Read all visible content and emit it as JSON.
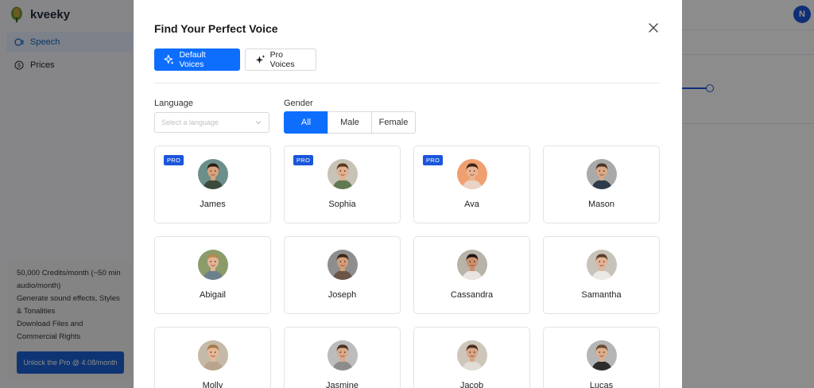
{
  "app": {
    "brand": "kveeky",
    "nav": [
      {
        "label": "Speech",
        "icon": "speech-icon",
        "active": true
      },
      {
        "label": "Prices",
        "icon": "dollar-icon",
        "active": false
      }
    ],
    "promo": {
      "lines": [
        "50,000 Credits/month (~50 min audio/month)",
        "Generate sound effects, Styles & Tonalities",
        "Download Files and Commercial Rights"
      ],
      "cta": "Unlock the Pro @ 4.08/month"
    },
    "user_initial": "N"
  },
  "modal": {
    "title": "Find Your Perfect Voice",
    "tabs": [
      {
        "label": "Default Voices",
        "icon": "sparkle-icon",
        "active": true
      },
      {
        "label": "Pro Voices",
        "icon": "sparkles-icon",
        "active": false
      }
    ],
    "language": {
      "label": "Language",
      "placeholder": "Select a language"
    },
    "gender": {
      "label": "Gender",
      "options": [
        "All",
        "Male",
        "Female"
      ],
      "selected": "All"
    },
    "pro_badge": "PRO",
    "voices": [
      {
        "name": "James",
        "pro": true,
        "hair": "#2b1d14",
        "shirt": "#3c4a3c",
        "skin": "#d9a27b",
        "bg": "#6b8f8a"
      },
      {
        "name": "Sophia",
        "pro": true,
        "hair": "#5a3a22",
        "shirt": "#5f7a53",
        "skin": "#e0b08f",
        "bg": "#c9c2b6"
      },
      {
        "name": "Ava",
        "pro": true,
        "hair": "#3d2417",
        "shirt": "#e9d3c4",
        "skin": "#e8b594",
        "bg": "#f0a070"
      },
      {
        "name": "Mason",
        "pro": false,
        "hair": "#4a3424",
        "shirt": "#2d3b4a",
        "skin": "#d8a886",
        "bg": "#a9a9a9"
      },
      {
        "name": "Abigail",
        "pro": false,
        "hair": "#b48a4e",
        "shirt": "#6c7f8c",
        "skin": "#e2b493",
        "bg": "#8b9b6a"
      },
      {
        "name": "Joseph",
        "pro": false,
        "hair": "#3b2518",
        "shirt": "#6a5548",
        "skin": "#d39d78",
        "bg": "#8e8e8e"
      },
      {
        "name": "Cassandra",
        "pro": false,
        "hair": "#1e140f",
        "shirt": "#e8e4df",
        "skin": "#c98f6c",
        "bg": "#b9b2a8"
      },
      {
        "name": "Samantha",
        "pro": false,
        "hair": "#5a3d2a",
        "shirt": "#ece8e3",
        "skin": "#e3b395",
        "bg": "#c7c2ba"
      },
      {
        "name": "Molly",
        "pro": false,
        "hair": "#a47a4a",
        "shirt": "#b9a48d",
        "skin": "#e6b898",
        "bg": "#c5b9a8"
      },
      {
        "name": "Jasmine",
        "pro": false,
        "hair": "#4b3222",
        "shirt": "#8c8c8c",
        "skin": "#dba987",
        "bg": "#bcbcbc"
      },
      {
        "name": "Jacob",
        "pro": false,
        "hair": "#4a3020",
        "shirt": "#e0ddd8",
        "skin": "#d9a584",
        "bg": "#cfc6bb"
      },
      {
        "name": "Lucas",
        "pro": false,
        "hair": "#6a4b33",
        "shirt": "#2c2c2c",
        "skin": "#dcae8c",
        "bg": "#b5b5b5"
      }
    ]
  },
  "colors": {
    "primary": "#0d6efd",
    "brand_blue": "#1a56db",
    "overlay": "rgba(0,0,0,0.45)"
  }
}
